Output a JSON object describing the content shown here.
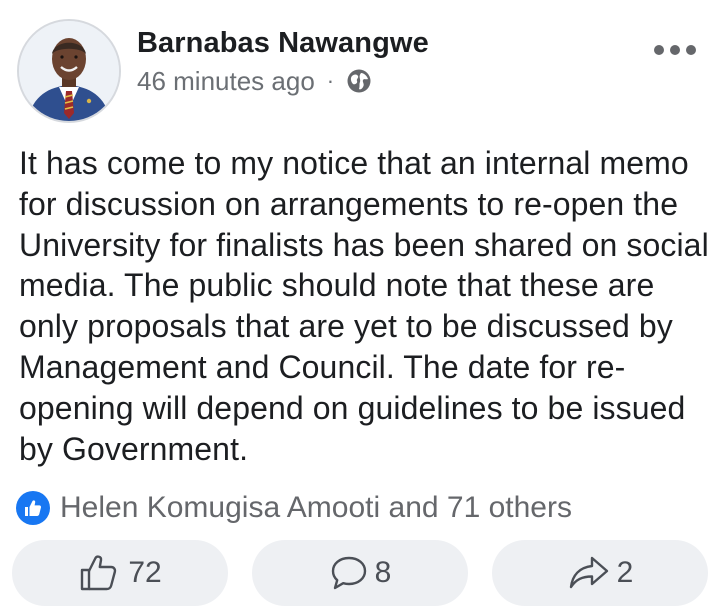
{
  "post": {
    "author": "Barnabas Nawangwe",
    "timestamp": "46 minutes ago",
    "separator": "·",
    "privacy_icon": "globe-icon",
    "more_icon": "more-options-icon",
    "text": "It has come to my notice that an internal memo for discussion on arrangements to re-open the University for finalists has been shared on social media. The public should note that these are only proposals that are yet to be discussed by Management and Council. The date for re-opening will depend on guidelines to be issued by Government."
  },
  "reactions": {
    "icon": "like-reaction-icon",
    "summary": "Helen Komugisa Amooti and 71 others"
  },
  "actions": {
    "like": {
      "icon": "thumbs-up-icon",
      "count": "72"
    },
    "comment": {
      "icon": "comment-icon",
      "count": "8"
    },
    "share": {
      "icon": "share-icon",
      "count": "2"
    }
  },
  "colors": {
    "accent": "#1877f2",
    "text": "#1c1e21",
    "secondary_text": "#65676b",
    "button_bg": "#eef0f3"
  }
}
